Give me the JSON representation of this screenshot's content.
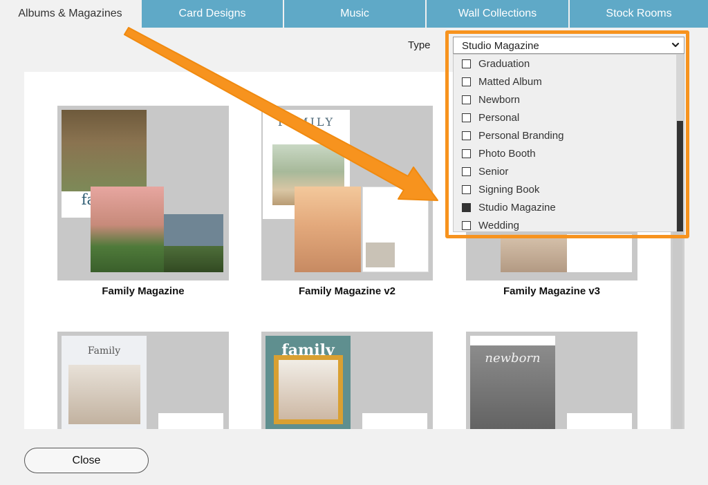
{
  "tabs": [
    {
      "label": "Albums & Magazines",
      "active": true
    },
    {
      "label": "Card Designs",
      "active": false
    },
    {
      "label": "Music",
      "active": false
    },
    {
      "label": "Wall Collections",
      "active": false
    },
    {
      "label": "Stock Rooms",
      "active": false
    }
  ],
  "filter": {
    "label": "Type",
    "selected": "Studio Magazine",
    "options": [
      {
        "label": "Graduation",
        "checked": false
      },
      {
        "label": "Matted Album",
        "checked": false
      },
      {
        "label": "Newborn",
        "checked": false
      },
      {
        "label": "Personal",
        "checked": false
      },
      {
        "label": "Personal Branding",
        "checked": false
      },
      {
        "label": "Photo Booth",
        "checked": false
      },
      {
        "label": "Senior",
        "checked": false
      },
      {
        "label": "Signing Book",
        "checked": false
      },
      {
        "label": "Studio Magazine",
        "checked": true
      },
      {
        "label": "Wedding",
        "checked": false
      }
    ]
  },
  "gallery": {
    "items": [
      {
        "title": "Family Magazine",
        "cover_text": "family"
      },
      {
        "title": "Family Magazine v2",
        "cover_text": "FAMILY"
      },
      {
        "title": "Family Magazine v3",
        "cover_text": ""
      },
      {
        "title": "",
        "cover_text": "Family"
      },
      {
        "title": "",
        "cover_text": "family"
      },
      {
        "title": "",
        "cover_text": "newborn"
      }
    ]
  },
  "footer": {
    "close_label": "Close"
  },
  "colors": {
    "tab_bg": "#5fa9c7",
    "highlight": "#f7931e"
  }
}
